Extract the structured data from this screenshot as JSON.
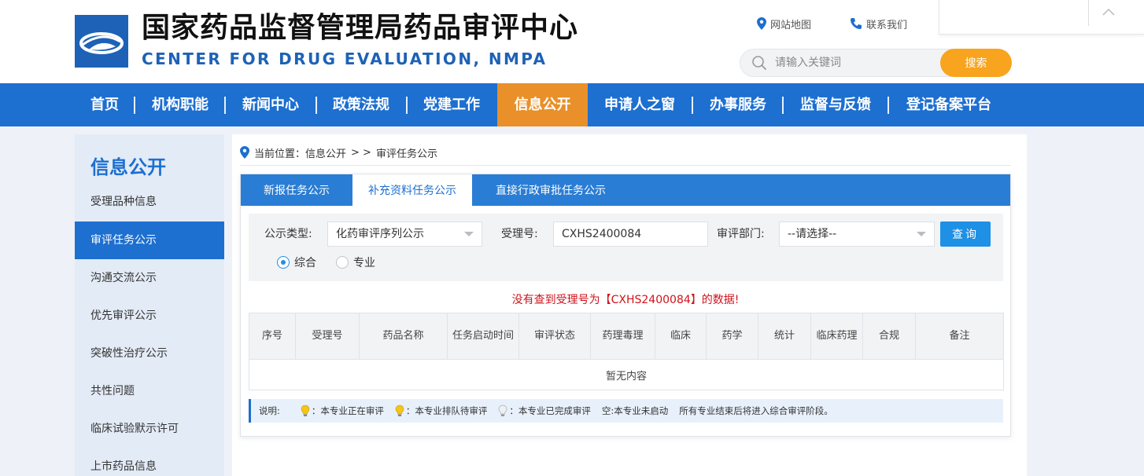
{
  "header": {
    "title_cn": "国家药品监督管理局药品审评中心",
    "title_en": "CENTER FOR DRUG EVALUATION, NMPA",
    "sitemap_label": "网站地图",
    "contact_label": "联系我们",
    "search_placeholder": "请输入关键词",
    "search_button": "搜索"
  },
  "nav": {
    "items": [
      {
        "label": "首页"
      },
      {
        "label": "机构职能"
      },
      {
        "label": "新闻中心"
      },
      {
        "label": "政策法规"
      },
      {
        "label": "党建工作"
      },
      {
        "label": "信息公开"
      },
      {
        "label": "申请人之窗"
      },
      {
        "label": "办事服务"
      },
      {
        "label": "监督与反馈"
      },
      {
        "label": "登记备案平台"
      }
    ],
    "active_index": 5
  },
  "sidebar": {
    "title": "信息公开",
    "items": [
      {
        "label": "受理品种信息"
      },
      {
        "label": "审评任务公示"
      },
      {
        "label": "沟通交流公示"
      },
      {
        "label": "优先审评公示"
      },
      {
        "label": "突破性治疗公示"
      },
      {
        "label": "共性问题"
      },
      {
        "label": "临床试验默示许可"
      },
      {
        "label": "上市药品信息"
      }
    ],
    "active_index": 1
  },
  "breadcrumb": {
    "prefix": "当前位置：信息公开",
    "sep": "> >",
    "current": "审评任务公示"
  },
  "tabs": [
    {
      "label": "新报任务公示"
    },
    {
      "label": "补充资料任务公示"
    },
    {
      "label": "直接行政审批任务公示"
    }
  ],
  "filter": {
    "type_label": "公示类型:",
    "type_value": "化药审评序列公示",
    "accept_label": "受理号:",
    "accept_value": "CXHS2400084",
    "dept_label": "审评部门:",
    "dept_value": "--请选择--",
    "query_button": "查询",
    "radio_all": "综合",
    "radio_pro": "专业",
    "radio_selected": "综合"
  },
  "message": "没有查到受理号为【CXHS2400084】的数据!",
  "table": {
    "headers": [
      "序号",
      "受理号",
      "药品名称",
      "任务启动时间",
      "审评状态",
      "药理毒理",
      "临床",
      "药学",
      "统计",
      "临床药理",
      "合规",
      "备注"
    ],
    "empty_text": "暂无内容"
  },
  "legend": {
    "label": "说明:",
    "in_review": "本专业正在审评",
    "queued": "本专业排队待审评",
    "done": "本专业已完成审评",
    "not_started_prefix": "空:",
    "not_started": "本专业未启动",
    "note": "所有专业结束后将进入综合审评阶段。"
  },
  "colors": {
    "brand_blue": "#1d6fd0",
    "nav_active": "#e9902a",
    "search_button": "#f8a41e",
    "query_button": "#1e90e6",
    "error_text": "#d0121b",
    "bulb_active": "#f5c518",
    "bulb_queued": "#f5c518",
    "bulb_done": "#d0d4da"
  }
}
